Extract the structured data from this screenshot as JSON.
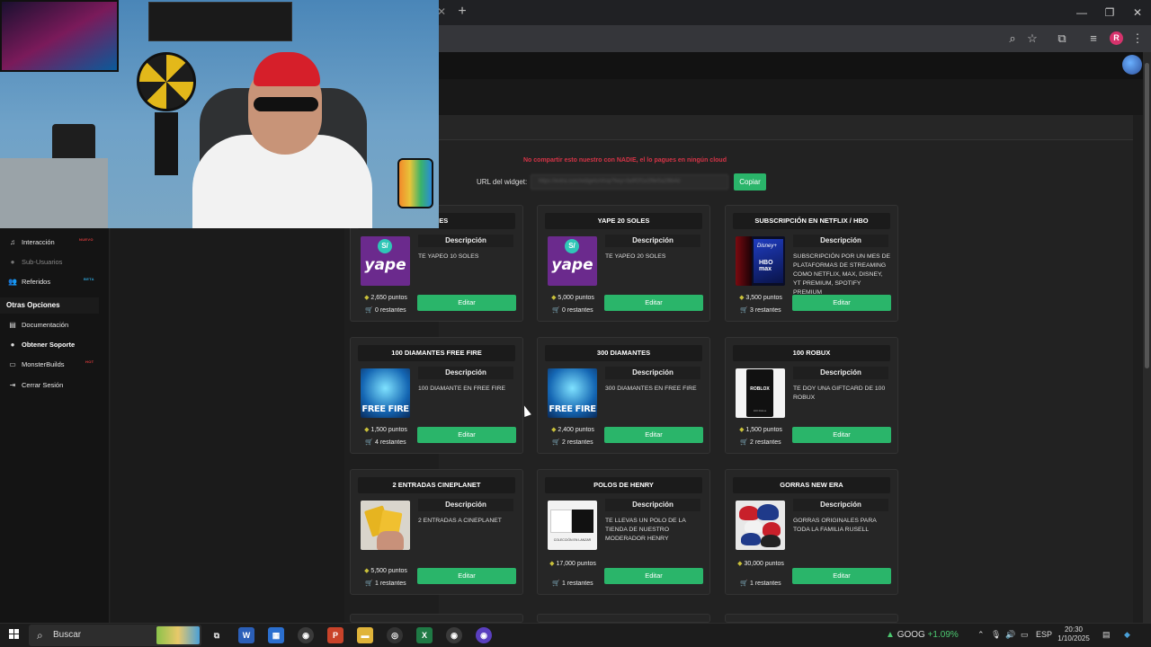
{
  "browser": {
    "new_tab": "+",
    "window_controls": [
      "—",
      "❐",
      "✕"
    ],
    "profile_initial": "R"
  },
  "warning_text": "No compartir esto nuestro con NADIE, el lo pagues en ningún cloud",
  "widget": {
    "label": "URL del widget:",
    "url": "https://extra.com/widgets/shop?key=3a9f2f1e2f8e5a1f8b4d",
    "copy_label": "Copiar"
  },
  "sidebar": {
    "items": [
      {
        "label": "Interacción",
        "badge": "NUEVO",
        "badge_color": "#e03c3c"
      },
      {
        "label": "Sub-Usuarios",
        "muted": true
      },
      {
        "label": "Referidos",
        "badge": "BETA",
        "badge_color": "#2fa4d8"
      }
    ],
    "section_title": "Otras Opciones",
    "options": [
      {
        "label": "Documentación"
      },
      {
        "label": "Obtener Soporte"
      },
      {
        "label": "MonsterBuilds",
        "badge": "HOT",
        "badge_color": "#e03c3c"
      },
      {
        "label": "Cerrar Sesión"
      }
    ]
  },
  "desc_header": "Descripción",
  "edit_label": "Editar",
  "cards": [
    {
      "title": "SOLES",
      "image": "yape-logo",
      "description": "TE YAPEO 10 SOLES",
      "points": "2,650 puntos",
      "remaining": "0 restantes"
    },
    {
      "title": "YAPE 20 SOLES",
      "image": "yape-logo",
      "description": "TE YAPEO 20 SOLES",
      "points": "5,000 puntos",
      "remaining": "0 restantes"
    },
    {
      "title": "SUBSCRIPCIÓN EN NETFLIX / HBO",
      "image": "streaming-logos",
      "description": "SUBSCRIPCIÓN POR UN MES DE PLATAFORMAS DE STREAMING COMO NETFLIX, MAX, DISNEY, YT PREMIUM, SPOTIFY PREMIUM",
      "points": "3,500 puntos",
      "remaining": "3 restantes"
    },
    {
      "title": "100 DIAMANTES FREE FIRE",
      "image": "free-fire",
      "description": "100 DIAMANTE EN FREE FIRE",
      "points": "1,500 puntos",
      "remaining": "4 restantes"
    },
    {
      "title": "300 DIAMANTES",
      "image": "free-fire",
      "description": "300 DIAMANTES EN FREE FIRE",
      "points": "2,400 puntos",
      "remaining": "2 restantes"
    },
    {
      "title": "100 ROBUX",
      "image": "roblox-card",
      "description": "TE DOY UNA GIFTCARD DE 100 ROBUX",
      "points": "1,500 puntos",
      "remaining": "2 restantes"
    },
    {
      "title": "2 ENTRADAS CINEPLANET",
      "image": "cinema-tickets",
      "description": "2 ENTRADAS A CINEPLANET",
      "points": "5,500 puntos",
      "remaining": "1 restantes"
    },
    {
      "title": "POLOS DE HENRY",
      "image": "t-shirts",
      "description": "TE LLEVAS UN POLO DE LA TIENDA DE NUESTRO MODERADOR HENRY",
      "points": "17,000 puntos",
      "remaining": "1 restantes"
    },
    {
      "title": "GORRAS NEW ERA",
      "image": "caps",
      "description": "GORRAS ORIGINALES PARA TODA LA FAMILIA RUSELL",
      "points": "30,000 puntos",
      "remaining": "1 restantes"
    }
  ],
  "card_images": {
    "yape_word": "yape",
    "yape_symbol": "S/",
    "netflix_top": "Disney+",
    "netflix_bottom": "HBO max",
    "ff_word": "FREE FIRE",
    "roblox_word": "ROBLOX",
    "roblox_sub": "100 Robux",
    "polo_caption": "COLECCIÓN EN LANZAR"
  },
  "taskbar": {
    "search_placeholder": "Buscar",
    "stock_symbol": "GOOG",
    "stock_change": "+1.09%",
    "language": "ESP",
    "time": "20:30",
    "date": "1/10/2025"
  }
}
